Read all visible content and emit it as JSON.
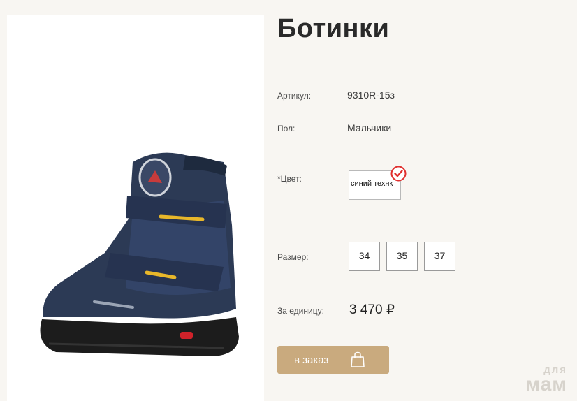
{
  "product": {
    "title": "Ботинки",
    "image_alt": "blue winter boot with two velcro straps"
  },
  "attributes": {
    "article_label": "Артикул:",
    "article_value": "9310R-15з",
    "gender_label": "Пол:",
    "gender_value": "Мальчики",
    "color_label": "*Цвет:",
    "color_value": "синий технк",
    "size_label": "Размер:",
    "sizes": [
      "34",
      "35",
      "37"
    ],
    "price_label": "За единицу:",
    "price_value": "3 470 ₽"
  },
  "actions": {
    "order_label": "в заказ"
  },
  "watermark": {
    "line1": "для",
    "line2": "мам"
  },
  "colors": {
    "accent": "#c9aa7e",
    "check": "#e0302f",
    "boot_navy": "#2c3a55",
    "boot_sole": "#1c1c1c",
    "strap_yellow": "#e8b72a"
  }
}
